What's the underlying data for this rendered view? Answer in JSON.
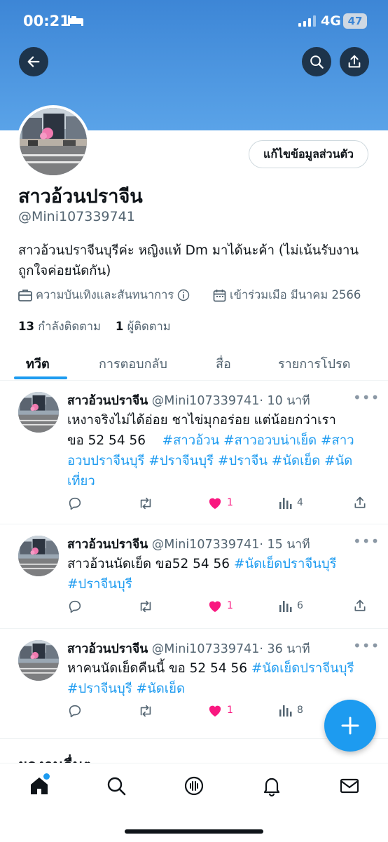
{
  "status_bar": {
    "time": "00:21",
    "network": "4G",
    "battery": "47"
  },
  "header": {
    "back_icon": "arrow-left-icon",
    "search_icon": "search-icon",
    "share_icon": "share-icon"
  },
  "profile": {
    "edit_label": "แก้ไขข้อมูลส่วนตัว",
    "name": "สาวอ้วนปราจีน",
    "handle": "@Mini107339741",
    "bio": "สาวอ้วนปราจีนบุรีค่ะ หญิงแท้ Dm มาได้นะค้า (ไม่เน้นรับงาน ถูกใจค่อยนัดกัน)",
    "category": "ความบันเทิงและสันทนาการ",
    "joined": "เข้าร่วมเมือ มีนาคม 2566",
    "following_count": "13",
    "following_label": "กำลังติดตาม",
    "followers_count": "1",
    "followers_label": "ผู้ติดตาม"
  },
  "tabs": [
    {
      "label": "ทวีต",
      "active": true
    },
    {
      "label": "การตอบกลับ",
      "active": false
    },
    {
      "label": "สื่อ",
      "active": false
    },
    {
      "label": "รายการโปรด",
      "active": false
    }
  ],
  "tweets": [
    {
      "name": "สาวอ้วนปราจีน",
      "handle": "@Mini107339741",
      "time": "· 10 นาที",
      "line1": "เหงาจริงไม่ได้อ่อย ชาไข่มุกอร่อย แต่น้อยกว่าเรา",
      "text_plain": "ขอ 52 54 56",
      "tags": "#สาวอ้วน #สาวอวบน่าเย็ด #สาวอวบปราจีนบุรี #ปราจีนบุรี #ปราจีน #นัดเย็ด #นัดเที่ยว",
      "likes": "1",
      "views": "4"
    },
    {
      "name": "สาวอ้วนปราจีน",
      "handle": "@Mini107339741",
      "time": "· 15 นาที",
      "text_plain": "สาวอ้วนนัดเย็ด   ขอ52 54 56",
      "tags": "#นัดเย็ดปราจีนบุรี #ปราจีนบุรี",
      "likes": "1",
      "views": "6"
    },
    {
      "name": "สาวอ้วนปราจีน",
      "handle": "@Mini107339741",
      "time": "· 36 นาที",
      "text_plain": "หาคนนัดเย็ดคืนนี้   ขอ 52 54 56",
      "tags": "#นัดเย็ดปราจีนบุรี #ปราจีนบุรี #นัดเย็ด",
      "likes": "1",
      "views": "8"
    }
  ],
  "peek_text": "ผลงานอื่นๆ",
  "bottom_nav": [
    "home-icon",
    "search-icon",
    "spaces-icon",
    "notifications-icon",
    "messages-icon"
  ],
  "colors": {
    "accent": "#1d9bf0",
    "like": "#f91880",
    "banner": "#4a94df"
  }
}
